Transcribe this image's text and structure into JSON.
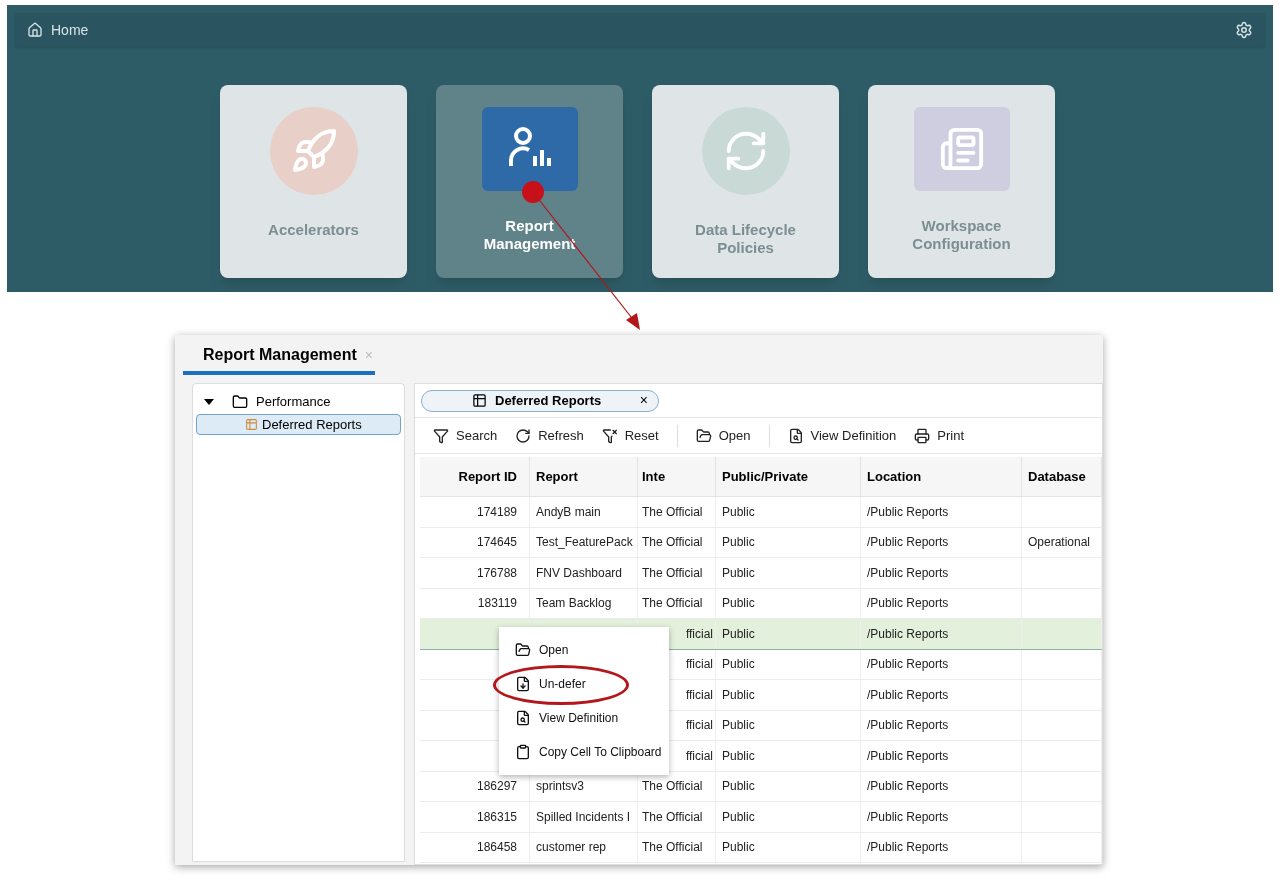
{
  "home": {
    "title": "Home",
    "tiles": [
      {
        "label": "Accelerators",
        "selected": false
      },
      {
        "label": "Report Management",
        "selected": true
      },
      {
        "label": "Data Lifecycle Policies",
        "selected": false
      },
      {
        "label": "Workspace Configuration",
        "selected": false
      }
    ]
  },
  "window": {
    "title": "Report Management",
    "close": "×",
    "tree": {
      "label": "Performance",
      "expanded": true,
      "children": [
        {
          "label": "Deferred Reports",
          "selected": true
        }
      ]
    },
    "tab": {
      "label": "Deferred Reports",
      "close": "×"
    },
    "toolbar": [
      "Search",
      "Refresh",
      "Reset",
      "Open",
      "View Definition",
      "Print"
    ],
    "table": {
      "columns": [
        "Report ID",
        "Report",
        "Inte",
        "Public/Private",
        "Location",
        "Database"
      ],
      "rows": [
        {
          "id": "174189",
          "report": "AndyB main",
          "column_3": "The Official",
          "access": "Public",
          "location": "/Public Reports",
          "selected": false
        },
        {
          "id": "174645",
          "report": "Test_FeaturePack",
          "column_3": "The Official",
          "access": "Public",
          "location": "/Public Reports",
          "database": "Operational",
          "selected": false
        },
        {
          "id": "176788",
          "report": "FNV Dashboard",
          "column_3": "The Official",
          "access": "Public",
          "location": "/Public Reports",
          "selected": false
        },
        {
          "id": "183119",
          "report": "Team Backlog",
          "column_3": "The Official",
          "access": "Public",
          "location": "/Public Reports",
          "selected": false
        },
        {
          "column_3": "fficial",
          "access": "Public",
          "location": "/Public Reports",
          "selected": true
        },
        {
          "column_3": "fficial",
          "access": "Public",
          "location": "/Public Reports",
          "selected": false
        },
        {
          "column_3": "fficial",
          "access": "Public",
          "location": "/Public Reports",
          "selected": false
        },
        {
          "column_3": "fficial",
          "access": "Public",
          "location": "/Public Reports",
          "selected": false
        },
        {
          "column_3": "fficial",
          "access": "Public",
          "location": "/Public Reports",
          "selected": false
        },
        {
          "id": "186297",
          "report": "sprintsv3",
          "column_3": "The Official",
          "access": "Public",
          "location": "/Public Reports",
          "selected": false
        },
        {
          "id": "186315",
          "report": "Spilled Incidents I",
          "column_3": "The Official",
          "access": "Public",
          "location": "/Public Reports",
          "selected": false
        },
        {
          "id": "186458",
          "report": "customer rep",
          "column_3": "The Official",
          "access": "Public",
          "location": "/Public Reports",
          "selected": false
        }
      ]
    },
    "context_menu": [
      {
        "label": "Open",
        "circled": false
      },
      {
        "label": "Un-defer",
        "circled": true
      },
      {
        "label": "View Definition",
        "circled": false
      },
      {
        "label": "Copy Cell To Clipboard",
        "circled": false
      }
    ]
  }
}
